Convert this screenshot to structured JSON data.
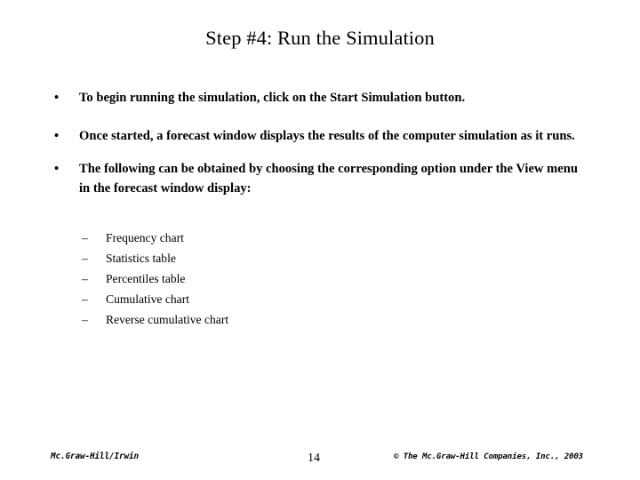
{
  "slide": {
    "title": "Step #4: Run the Simulation",
    "bullet_marker": "•",
    "sub_bullet_marker": "–",
    "bullets": [
      {
        "text": "To begin running the simulation, click on the Start Simulation button."
      },
      {
        "text": "Once started, a forecast window displays the results of the computer simulation as it runs."
      },
      {
        "text": "The following can be obtained by choosing the corresponding option under the View menu in the forecast window display:"
      }
    ],
    "sub_bullets": [
      {
        "label": "Frequency chart"
      },
      {
        "label": "Statistics table"
      },
      {
        "label": "Percentiles table"
      },
      {
        "label": "Cumulative chart"
      },
      {
        "label": "Reverse cumulative chart"
      }
    ],
    "footer": {
      "publisher": "Mc.Graw-Hill/Irwin",
      "page_number": "14",
      "copyright": "© The Mc.Graw-Hill Companies, Inc., 2003"
    },
    "colors": {
      "background": "#ffffff",
      "text": "#000000"
    }
  }
}
